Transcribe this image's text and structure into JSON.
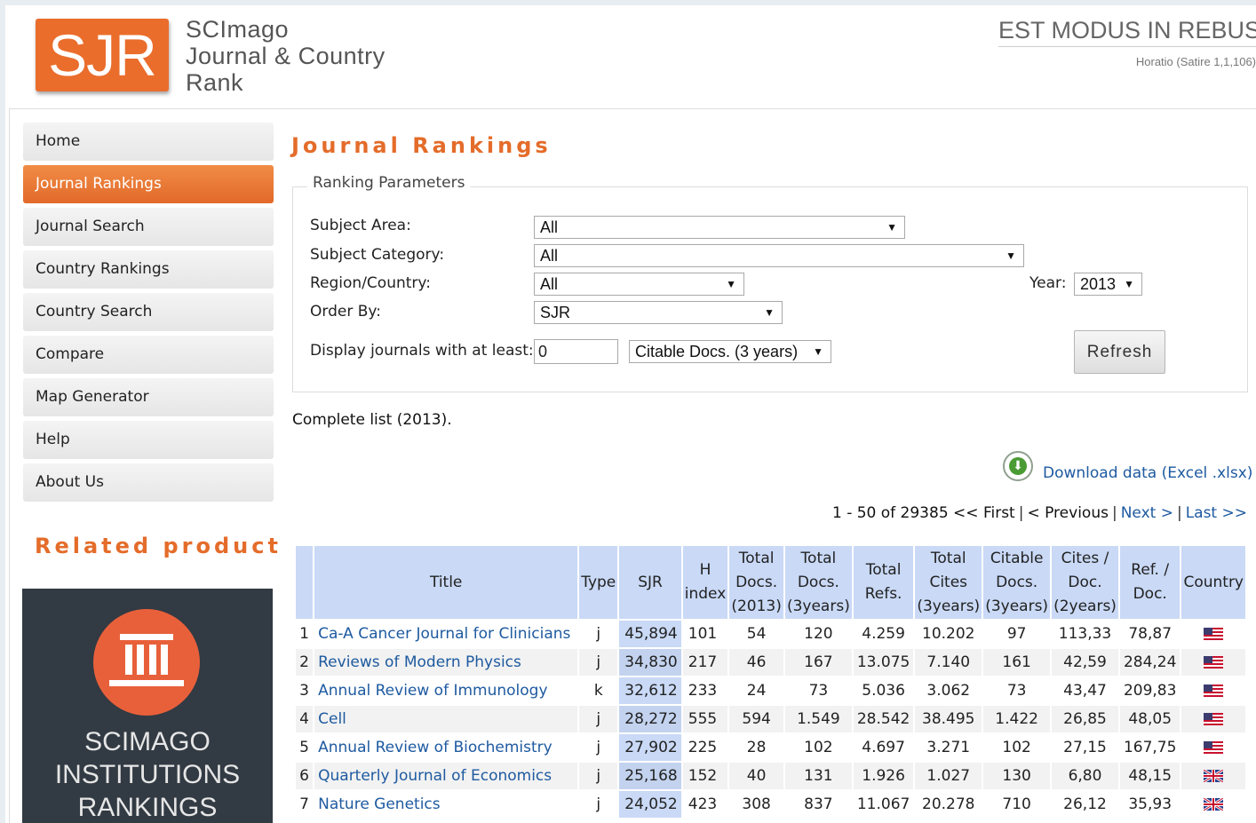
{
  "header": {
    "logo_text": "SJR",
    "brand_lines": [
      "SCImago",
      "Journal & Country",
      "Rank"
    ],
    "motto": "EST MODUS IN REBUS",
    "motto_source": "Horatio (Satire 1,1,106)"
  },
  "nav": {
    "items": [
      "Home",
      "Journal Rankings",
      "Journal Search",
      "Country Rankings",
      "Country Search",
      "Compare",
      "Map Generator",
      "Help",
      "About Us"
    ],
    "active": "Journal Rankings"
  },
  "related": {
    "title": "Related product",
    "promo_lines": [
      "SCIMAGO",
      "INSTITUTIONS",
      "RANKINGS"
    ],
    "icon": "institution-building-icon"
  },
  "main": {
    "title": "Journal Rankings",
    "params_legend": "Ranking Parameters",
    "subject_area": {
      "label": "Subject Area:",
      "value": "All"
    },
    "subject_category": {
      "label": "Subject Category:",
      "value": "All"
    },
    "region": {
      "label": "Region/Country:",
      "value": "All"
    },
    "year": {
      "label": "Year:",
      "value": "2013"
    },
    "order_by": {
      "label": "Order By:",
      "value": "SJR"
    },
    "min_display": {
      "label": "Display journals with at least:",
      "value": "0",
      "unit": "Citable Docs. (3 years)"
    },
    "refresh_label": "Refresh",
    "complete_list": "Complete list (2013).",
    "download_label": "Download data (Excel .xlsx)",
    "pager": {
      "range": "1 - 50 of 29385",
      "first": "<< First",
      "previous": "< Previous",
      "next": "Next >",
      "last": "Last >>"
    }
  },
  "table": {
    "headers": {
      "title": "Title",
      "type": "Type",
      "sjr": "SJR",
      "h_index": [
        "H",
        "index"
      ],
      "total_docs_2013": [
        "Total",
        "Docs.",
        "(2013)"
      ],
      "total_docs_3y": [
        "Total",
        "Docs.",
        "(3years)"
      ],
      "total_refs": [
        "Total",
        "Refs."
      ],
      "total_cites_3y": [
        "Total",
        "Cites",
        "(3years)"
      ],
      "citable_docs_3y": [
        "Citable",
        "Docs.",
        "(3years)"
      ],
      "cites_doc_2y": [
        "Cites /",
        "Doc.",
        "(2years)"
      ],
      "ref_doc": [
        "Ref. /",
        "Doc."
      ],
      "country": "Country"
    },
    "rows": [
      {
        "rank": "1",
        "title": "Ca-A Cancer Journal for Clinicians",
        "type": "j",
        "sjr": "45,894",
        "h": "101",
        "docs2013": "54",
        "docs3y": "120",
        "refs": "4.259",
        "cites3y": "10.202",
        "citable3y": "97",
        "cites_doc": "113,33",
        "ref_doc": "78,87",
        "flag": "us-flag-icon"
      },
      {
        "rank": "2",
        "title": "Reviews of Modern Physics",
        "type": "j",
        "sjr": "34,830",
        "h": "217",
        "docs2013": "46",
        "docs3y": "167",
        "refs": "13.075",
        "cites3y": "7.140",
        "citable3y": "161",
        "cites_doc": "42,59",
        "ref_doc": "284,24",
        "flag": "us-flag-icon"
      },
      {
        "rank": "3",
        "title": "Annual Review of Immunology",
        "type": "k",
        "sjr": "32,612",
        "h": "233",
        "docs2013": "24",
        "docs3y": "73",
        "refs": "5.036",
        "cites3y": "3.062",
        "citable3y": "73",
        "cites_doc": "43,47",
        "ref_doc": "209,83",
        "flag": "us-flag-icon"
      },
      {
        "rank": "4",
        "title": "Cell",
        "type": "j",
        "sjr": "28,272",
        "h": "555",
        "docs2013": "594",
        "docs3y": "1.549",
        "refs": "28.542",
        "cites3y": "38.495",
        "citable3y": "1.422",
        "cites_doc": "26,85",
        "ref_doc": "48,05",
        "flag": "us-flag-icon"
      },
      {
        "rank": "5",
        "title": "Annual Review of Biochemistry",
        "type": "j",
        "sjr": "27,902",
        "h": "225",
        "docs2013": "28",
        "docs3y": "102",
        "refs": "4.697",
        "cites3y": "3.271",
        "citable3y": "102",
        "cites_doc": "27,15",
        "ref_doc": "167,75",
        "flag": "us-flag-icon"
      },
      {
        "rank": "6",
        "title": "Quarterly Journal of Economics",
        "type": "j",
        "sjr": "25,168",
        "h": "152",
        "docs2013": "40",
        "docs3y": "131",
        "refs": "1.926",
        "cites3y": "1.027",
        "citable3y": "130",
        "cites_doc": "6,80",
        "ref_doc": "48,15",
        "flag": "uk-flag-icon"
      },
      {
        "rank": "7",
        "title": "Nature Genetics",
        "type": "j",
        "sjr": "24,052",
        "h": "423",
        "docs2013": "308",
        "docs3y": "837",
        "refs": "11.067",
        "cites3y": "20.278",
        "citable3y": "710",
        "cites_doc": "26,12",
        "ref_doc": "35,93",
        "flag": "uk-flag-icon"
      }
    ]
  },
  "colors": {
    "accent": "#e46c2a",
    "link": "#1e5aa0",
    "table_header": "#c9d9f6"
  }
}
